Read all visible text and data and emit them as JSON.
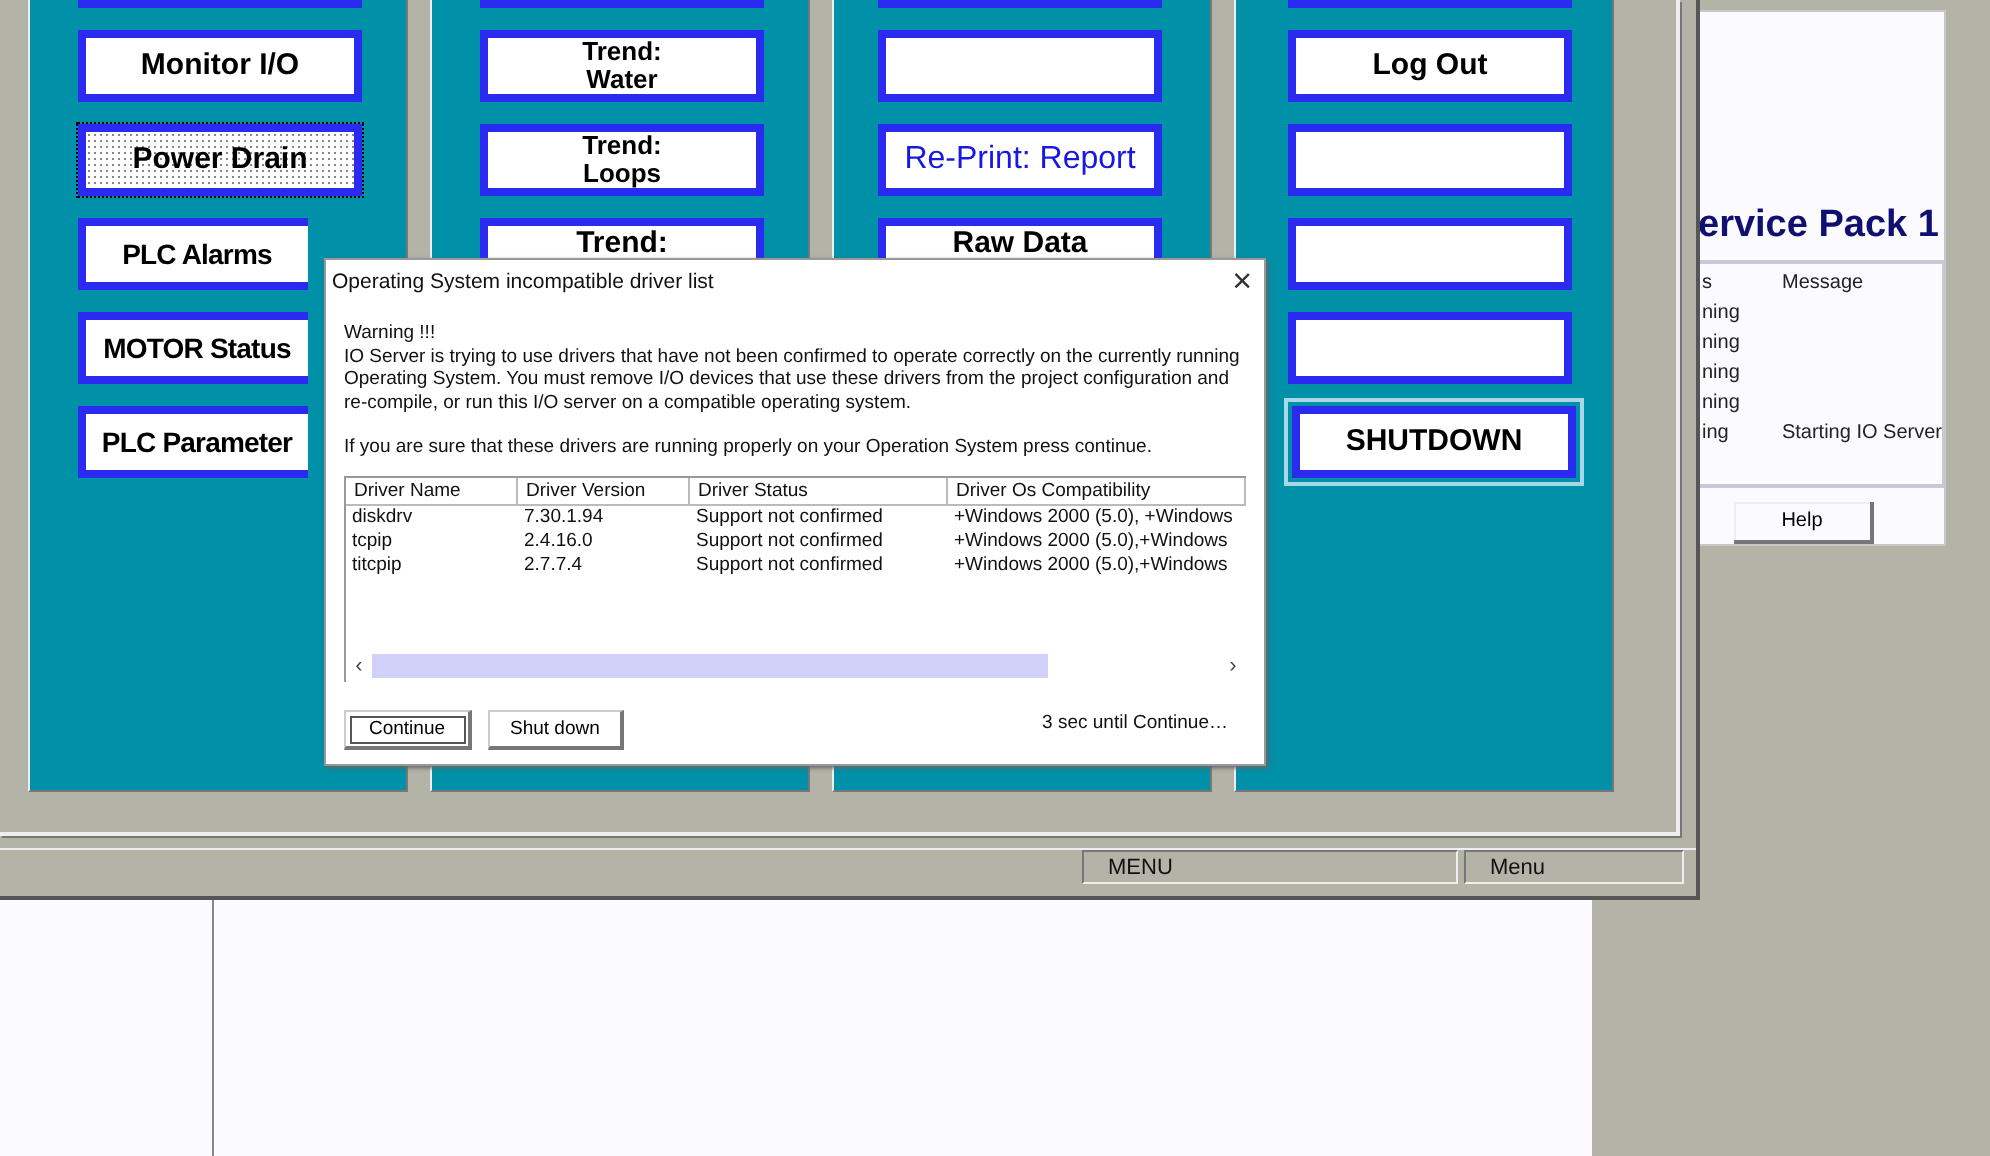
{
  "background_window": {
    "title": "ervice Pack 1",
    "columns": [
      "s",
      "Message"
    ],
    "rows": [
      {
        "status": "ning",
        "message": ""
      },
      {
        "status": "ning",
        "message": ""
      },
      {
        "status": "ning",
        "message": ""
      },
      {
        "status": "ning",
        "message": ""
      },
      {
        "status": "ing",
        "message": "Starting IO Server"
      }
    ],
    "help_button": "Help"
  },
  "hmi_columns": [
    {
      "buttons": [
        {
          "kind": "plain"
        },
        {
          "lines": [
            "Monitor I/O"
          ],
          "kind": "plain"
        },
        {
          "lines": [
            "Power Drain"
          ],
          "kind": "focused"
        },
        {
          "lines": [
            "PLC Alarms"
          ],
          "kind": "plain"
        },
        {
          "lines": [
            "MOTOR Status"
          ],
          "kind": "plain"
        },
        {
          "lines": [
            "PLC Parameter"
          ],
          "kind": "plain"
        }
      ]
    },
    {
      "buttons": [
        {
          "kind": "plain"
        },
        {
          "lines": [
            "Trend:",
            "Water"
          ],
          "kind": "plain"
        },
        {
          "lines": [
            "Trend:",
            "Loops"
          ],
          "kind": "plain"
        },
        {
          "lines": [
            "Trend:"
          ],
          "kind": "plain"
        }
      ]
    },
    {
      "buttons": [
        {
          "kind": "plain"
        },
        {
          "kind": "plain"
        },
        {
          "lines": [
            "Re-Print: Report"
          ],
          "kind": "link"
        },
        {
          "lines": [
            "Raw Data"
          ],
          "kind": "plain"
        }
      ]
    },
    {
      "buttons": [
        {
          "kind": "plain"
        },
        {
          "lines": [
            "Log Out"
          ],
          "kind": "plain"
        },
        {
          "kind": "plain"
        },
        {
          "kind": "plain"
        },
        {
          "kind": "plain"
        },
        {
          "lines": [
            "SHUTDOWN"
          ],
          "kind": "default"
        }
      ]
    }
  ],
  "status_bar": {
    "panels": [
      "MENU",
      "Menu"
    ]
  },
  "dialog": {
    "title": "Operating System incompatible driver list",
    "close": "×",
    "warning": "Warning !!!",
    "message": "IO Server is trying to use drivers that have not been confirmed to operate correctly on the currently running Operating System. You must remove I/O devices that use these drivers from the project configuration and re-compile, or run this I/O server on a compatible operating system.",
    "hint": "If you are sure that these drivers are running properly on your Operation System press continue.",
    "table": {
      "columns": [
        "Driver Name",
        "Driver Version",
        "Driver Status",
        "Driver Os Compatibility"
      ],
      "rows": [
        {
          "name": "diskdrv",
          "version": "7.30.1.94",
          "status": "Support not confirmed",
          "compatibility": "+Windows 2000 (5.0), +Windows"
        },
        {
          "name": "tcpip",
          "version": "2.4.16.0",
          "status": "Support not confirmed",
          "compatibility": "+Windows 2000 (5.0),+Windows"
        },
        {
          "name": "titcpip",
          "version": "2.7.7.4",
          "status": "Support not confirmed",
          "compatibility": "+Windows 2000 (5.0),+Windows"
        }
      ],
      "scroll_arrows": [
        "‹",
        "›"
      ]
    },
    "buttons": [
      {
        "label": "Continue",
        "default": true
      },
      {
        "label": "Shut down",
        "default": false
      }
    ],
    "countdown": "3 sec until Continue…"
  }
}
